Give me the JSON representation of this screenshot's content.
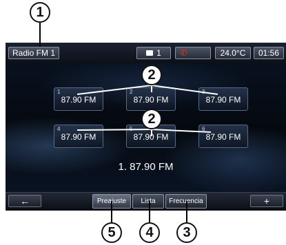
{
  "callouts": [
    "1",
    "2",
    "2",
    "5",
    "4",
    "3"
  ],
  "status_bar": {
    "source_label": "Radio FM 1",
    "messages_count": "1",
    "phone_icon": "missed-call-phone-icon",
    "temperature": "24.0°C",
    "time": "01:56"
  },
  "presets": [
    {
      "number": "1",
      "freq": "87.90 FM"
    },
    {
      "number": "2",
      "freq": "87.90 FM"
    },
    {
      "number": "3",
      "freq": "87.90 FM"
    },
    {
      "number": "4",
      "freq": "87.90 FM"
    },
    {
      "number": "5",
      "freq": "87.90 FM"
    },
    {
      "number": "6",
      "freq": "87.90 FM"
    }
  ],
  "current_station": "1. 87.90 FM",
  "bottom_bar": {
    "back_symbol": "←",
    "tabs": [
      "Preajuste",
      "Lista",
      "Frecuencia"
    ],
    "plus_symbol": "+"
  },
  "colors": {
    "accent_phone": "#e0302a",
    "screen_bg": "#05090f"
  }
}
